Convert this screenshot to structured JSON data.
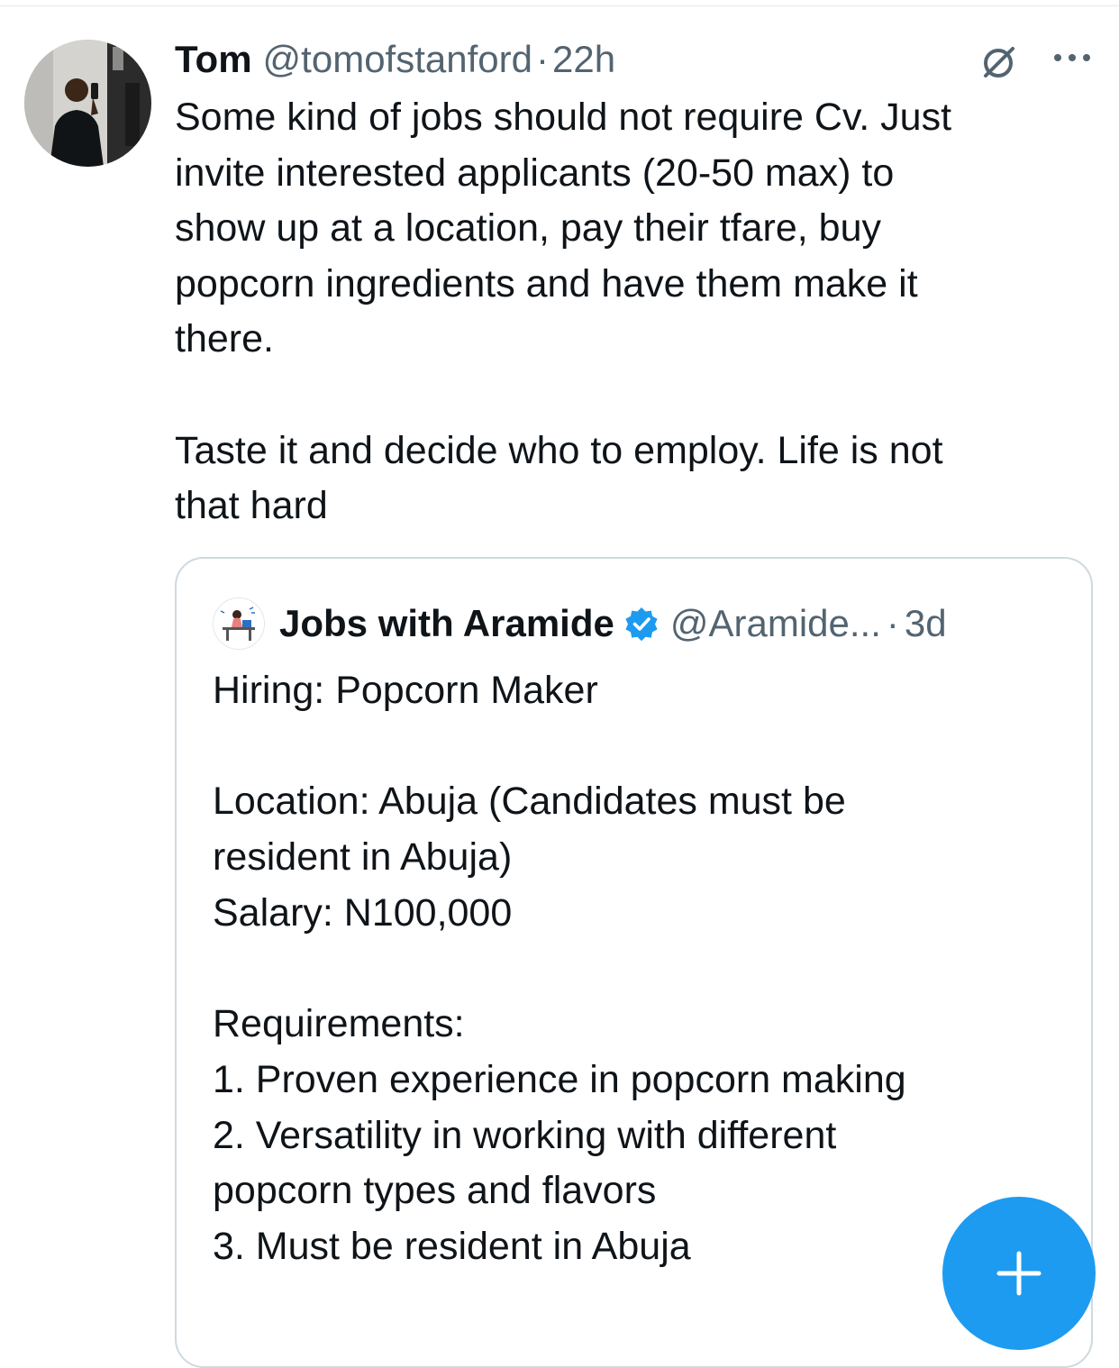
{
  "tweet": {
    "author_name": "Tom",
    "author_handle": "@tomofstanford",
    "separator": "·",
    "time": "22h",
    "text_lines": [
      "Some kind of jobs should not require Cv. Just",
      "invite interested applicants (20-50 max) to",
      "show up at a location, pay their tfare, buy",
      "popcorn ingredients and have them make it",
      "there."
    ],
    "text_lines_2": [
      "Taste it and decide who to employ. Life is not",
      "that hard"
    ]
  },
  "quoted_tweet": {
    "author_name": "Jobs with Aramide",
    "author_handle": "@Aramide...",
    "separator": "·",
    "time": "3d",
    "line_title": "Hiring: Popcorn Maker",
    "line_location_1": "Location: Abuja (Candidates must be",
    "line_location_2": "resident in Abuja)",
    "line_salary": "Salary: N100,000",
    "line_requirements": "Requirements:",
    "line_req_1": "1. Proven experience in popcorn making",
    "line_req_2a": "2. Versatility in working with different",
    "line_req_2b": "popcorn types and flavors",
    "line_req_3": "3. Must be resident in Abuja"
  },
  "colors": {
    "accent": "#1d9bf0",
    "text_primary": "#0f1419",
    "text_secondary": "#536471",
    "border": "#cfd9de"
  },
  "icons": {
    "grok": "grok-slash-circle-icon",
    "more": "more-horizontal-icon",
    "verified": "verified-badge-icon",
    "compose": "plus-icon"
  }
}
